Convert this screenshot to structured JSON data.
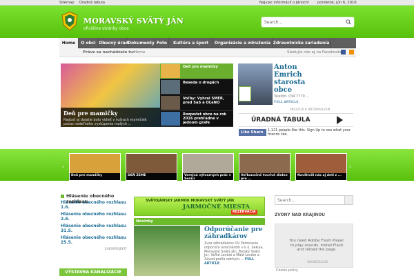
{
  "toplinks": {
    "left": [
      "Sitemap",
      "Úradná tabula"
    ],
    "news": "Najviac informácií o Jánoch!",
    "date": "pondelok, jún 6, 2016"
  },
  "brand": {
    "title": "MORAVSKÝ SVÄTÝ JÁN",
    "subtitle": "oficiálne stránky obce"
  },
  "search": {
    "placeholder": "Search..."
  },
  "nav": [
    "Home",
    "O obci",
    "Obecný úrad",
    "Dokumenty",
    "Foto",
    "Kultúra a šport",
    "Organizácie a združenia",
    "Zdravotnícke zariadenia"
  ],
  "crumbs": {
    "label": "Práve sa nachádzate tu:",
    "current": "Home",
    "fb": "Sledujte nás aj na Facebooku!"
  },
  "slider": {
    "title": "Deň pre mamičky",
    "text": "Radosť aj dojatie bolo vidieť v tvárach mamičiek počas nedeľného vystúpenia malých ...",
    "thumbs": [
      "Deň pre mamičky",
      "Beseda o drogách",
      "Voľby: Vyhral SMER, pred SaS a OĽaNO",
      "Rozpočet obce na rok 2016 prehľadne v jednom grafe"
    ]
  },
  "profile": {
    "name": "Anton Emrich starosta obce",
    "tel": "Telefón: 034 7770 ...",
    "full": "FULL ARTICLE"
  },
  "presti": "PRESTUP K INFORMACIAM",
  "uradna": "ÚRADNÁ TABULA",
  "fb": {
    "like": "Like",
    "share": "Share",
    "text": "1,121 people like this. Sign Up to see what your friends like."
  },
  "carousel": [
    "Deň pre mamičky",
    "DEŇ ZEME",
    "Verejná výtvarných prác v Senici",
    "Veľkonočné tvorivé dielne pre ...",
    "Navštívili nás aj deti z ..."
  ],
  "col1": {
    "title": "Hlásenie obecného rozhlasu",
    "items": [
      "Hlásenie obecného rozhlasu 1.6.",
      "Hlásenie obecného rozhlasu 2.6.",
      "Hlásenie obecného rozhlasu 31.5.",
      "Hlásenie obecného rozhlasu 25.5."
    ],
    "europ": "EUROPROJEKTY",
    "bottom": "VÝSTAVBA KANALIZÁCIE"
  },
  "banner": {
    "small": "SVÄTOJÁNSKY JARMOK MORAVSKÝ SVÄTÝ JÁN",
    "big": "JARMOČNÉ MIESTA",
    "tag": "REZERVÁCIA"
  },
  "novinky": "Novinky",
  "news": {
    "title": "Odporúčanie pre záhradkárov",
    "text": "Zväz záhradkárov OV Pomoravie odporúča ovocinárom v k.ú. Sekule, Moravský Svätý Ján, Borský Svätý Jur, Veľké Leváre a Malé Leváre a Závod podľa odchytu ...",
    "full": "FULL ARTICLE"
  },
  "right": {
    "placeholder": "Search...",
    "zvony": "ZVONY NAD KRAJINOU",
    "flash": "You need Adobe Flash Player to play sounds. Install Flash and reload the page.",
    "sc": "SOUNDCLOUD",
    "cookie": "Cookie policy"
  }
}
